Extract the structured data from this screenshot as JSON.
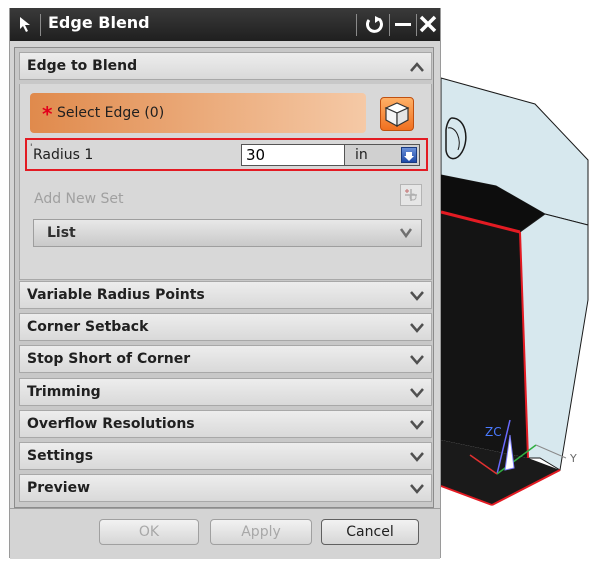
{
  "dialog": {
    "title": "Edge Blend",
    "title_buttons": [
      "reset-icon",
      "minimize-icon",
      "close-icon"
    ]
  },
  "edge_to_blend": {
    "header": "Edge to Blend",
    "select_edge_label": "Select Edge (0)",
    "radius_label": "Radius 1",
    "radius_value": "30",
    "radius_unit": "in",
    "add_new_set_label": "Add New Set",
    "list_label": "List"
  },
  "sections": [
    {
      "label": "Variable Radius Points"
    },
    {
      "label": "Corner Setback"
    },
    {
      "label": "Stop Short of Corner"
    },
    {
      "label": "Trimming"
    },
    {
      "label": "Overflow Resolutions"
    },
    {
      "label": "Settings"
    },
    {
      "label": "Preview"
    }
  ],
  "footer": {
    "ok_label": "OK",
    "apply_label": "Apply",
    "cancel_label": "Cancel"
  },
  "viewport": {
    "axis_z_label": "ZC",
    "axis_y_label": "Y"
  },
  "colors": {
    "title_bar": "#262626",
    "select_edge_gradient_start": "#e08a4c",
    "highlight_border": "#e31b23",
    "part_face": "#d7e8ee"
  }
}
